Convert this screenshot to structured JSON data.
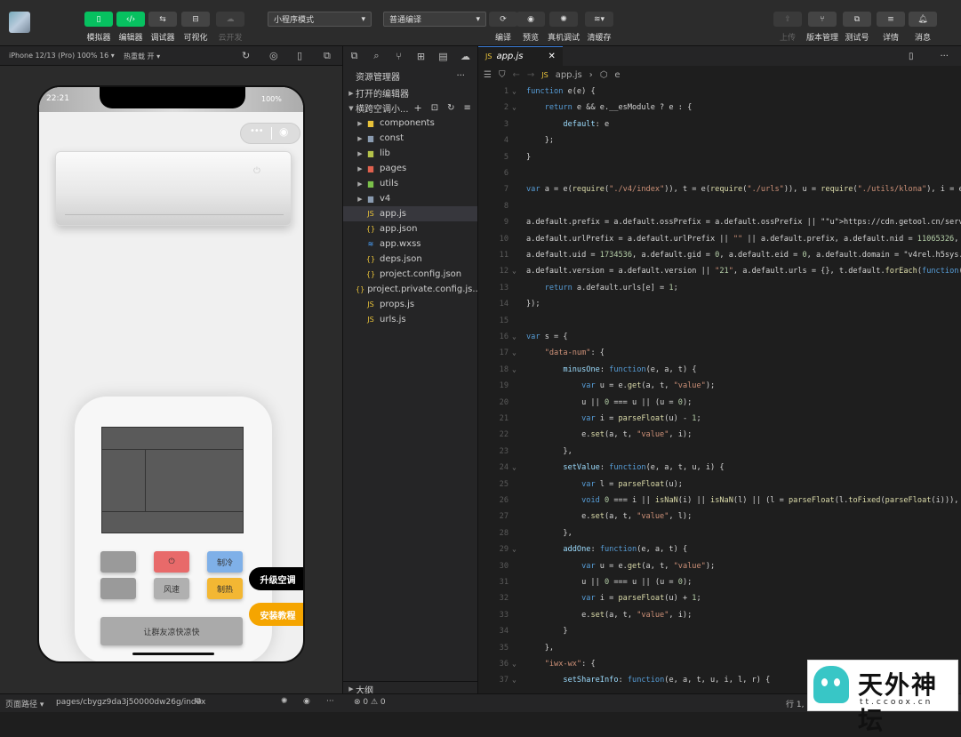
{
  "toolbar": {
    "buttons": [
      {
        "label": "模拟器",
        "icon": "phone-icon"
      },
      {
        "label": "编辑器",
        "icon": "code-icon"
      },
      {
        "label": "调试器",
        "icon": "debug-icon"
      },
      {
        "label": "可视化",
        "icon": "layout-icon"
      },
      {
        "label": "云开发",
        "icon": "cloud-icon"
      }
    ],
    "mode_select": "小程序模式",
    "compile_select": "普通编译",
    "actions": [
      {
        "label": "编译",
        "icon": "refresh-icon"
      },
      {
        "label": "预览",
        "icon": "eye-icon"
      },
      {
        "label": "真机调试",
        "icon": "bug-icon"
      },
      {
        "label": "清缓存",
        "icon": "layers-icon"
      }
    ],
    "right_actions": [
      {
        "label": "上传",
        "icon": "upload-icon"
      },
      {
        "label": "版本管理",
        "icon": "branch-icon"
      },
      {
        "label": "测试号",
        "icon": "test-icon"
      },
      {
        "label": "详情",
        "icon": "menu-icon"
      },
      {
        "label": "消息",
        "icon": "bell-icon"
      }
    ]
  },
  "simulator": {
    "device": "iPhone 12/13 (Pro) 100% 16",
    "hot_reload": "热重载 开",
    "time": "22:21",
    "battery": "100%",
    "buttons": {
      "cool": "制冷",
      "wind": "风速",
      "heat": "制热",
      "power": "⏻",
      "bottom": "让群友凉快凉快"
    },
    "side": {
      "upgrade": "升级空调",
      "tutorial": "安装教程"
    }
  },
  "explorer": {
    "title": "资源管理器",
    "open_editors": "打开的编辑器",
    "project": "横跨空调小...",
    "tree": [
      {
        "name": "components",
        "type": "folder",
        "color": "#e8c23a"
      },
      {
        "name": "const",
        "type": "folder",
        "color": "#8a9bb0"
      },
      {
        "name": "lib",
        "type": "folder",
        "color": "#b4c24a"
      },
      {
        "name": "pages",
        "type": "folder",
        "color": "#e0614e"
      },
      {
        "name": "utils",
        "type": "folder",
        "color": "#7bc04a"
      },
      {
        "name": "v4",
        "type": "folder",
        "color": "#8a9bb0"
      },
      {
        "name": "app.js",
        "type": "js"
      },
      {
        "name": "app.json",
        "type": "json"
      },
      {
        "name": "app.wxss",
        "type": "wxss"
      },
      {
        "name": "deps.json",
        "type": "json"
      },
      {
        "name": "project.config.json",
        "type": "json"
      },
      {
        "name": "project.private.config.js...",
        "type": "json"
      },
      {
        "name": "props.js",
        "type": "js"
      },
      {
        "name": "urls.js",
        "type": "js"
      }
    ],
    "outline": "大纲"
  },
  "editor": {
    "tab": "app.js",
    "breadcrumb": [
      "app.js",
      "e"
    ],
    "lines": [
      {
        "n": "1",
        "t": "function e(e) {"
      },
      {
        "n": "2",
        "t": "    return e && e.__esModule ? e : {"
      },
      {
        "n": "3",
        "t": "        default: e"
      },
      {
        "n": "4",
        "t": "    };"
      },
      {
        "n": "5",
        "t": "}"
      },
      {
        "n": "6",
        "t": ""
      },
      {
        "n": "7",
        "t": "var a = e(require(\"./v4/index\")), t = e(require(\"./urls\")), u = require(\"./utils/klona\"), i = e("
      },
      {
        "n": "8",
        "t": ""
      },
      {
        "n": "9",
        "t": "a.default.prefix = a.default.ossPrefix = a.default.ossPrefix || \"https://cdn.getool.cn/service/f"
      },
      {
        "n": "10",
        "t": "a.default.urlPrefix = a.default.urlPrefix || \"\" || a.default.prefix, a.default.nid = 11065326,"
      },
      {
        "n": "11",
        "t": "a.default.uid = 1734536, a.default.gid = 0, a.default.eid = 0, a.default.domain = \"v4rel.h5sys.c"
      },
      {
        "n": "12",
        "t": "a.default.version = a.default.version || \"21\", a.default.urls = {}, t.default.forEach(function(e"
      },
      {
        "n": "13",
        "t": "    return a.default.urls[e] = 1;"
      },
      {
        "n": "14",
        "t": "});"
      },
      {
        "n": "15",
        "t": ""
      },
      {
        "n": "16",
        "t": "var s = {"
      },
      {
        "n": "17",
        "t": "    \"data-num\": {"
      },
      {
        "n": "18",
        "t": "        minusOne: function(e, a, t) {"
      },
      {
        "n": "19",
        "t": "            var u = e.get(a, t, \"value\");"
      },
      {
        "n": "20",
        "t": "            u || 0 === u || (u = 0);"
      },
      {
        "n": "21",
        "t": "            var i = parseFloat(u) - 1;"
      },
      {
        "n": "22",
        "t": "            e.set(a, t, \"value\", i);"
      },
      {
        "n": "23",
        "t": "        },"
      },
      {
        "n": "24",
        "t": "        setValue: function(e, a, t, u, i) {"
      },
      {
        "n": "25",
        "t": "            var l = parseFloat(u);"
      },
      {
        "n": "26",
        "t": "            void 0 === i || isNaN(i) || isNaN(l) || (l = parseFloat(l.toFixed(parseFloat(i))),"
      },
      {
        "n": "27",
        "t": "            e.set(a, t, \"value\", l);"
      },
      {
        "n": "28",
        "t": "        },"
      },
      {
        "n": "29",
        "t": "        addOne: function(e, a, t) {"
      },
      {
        "n": "30",
        "t": "            var u = e.get(a, t, \"value\");"
      },
      {
        "n": "31",
        "t": "            u || 0 === u || (u = 0);"
      },
      {
        "n": "32",
        "t": "            var i = parseFloat(u) + 1;"
      },
      {
        "n": "33",
        "t": "            e.set(a, t, \"value\", i);"
      },
      {
        "n": "34",
        "t": "        }"
      },
      {
        "n": "35",
        "t": "    },"
      },
      {
        "n": "36",
        "t": "    \"iwx-wx\": {"
      },
      {
        "n": "37",
        "t": "        setShareInfo: function(e, a, t, u, i, l, r) {"
      }
    ]
  },
  "status": {
    "path_label": "页面路径",
    "path": "pages/cbygz9da3j50000dw26g/index",
    "problems": "⊗ 0 ⚠ 0",
    "position": "行 1,"
  },
  "watermark": {
    "text": "天外神坛",
    "url": "tt.ccoox.cn"
  }
}
